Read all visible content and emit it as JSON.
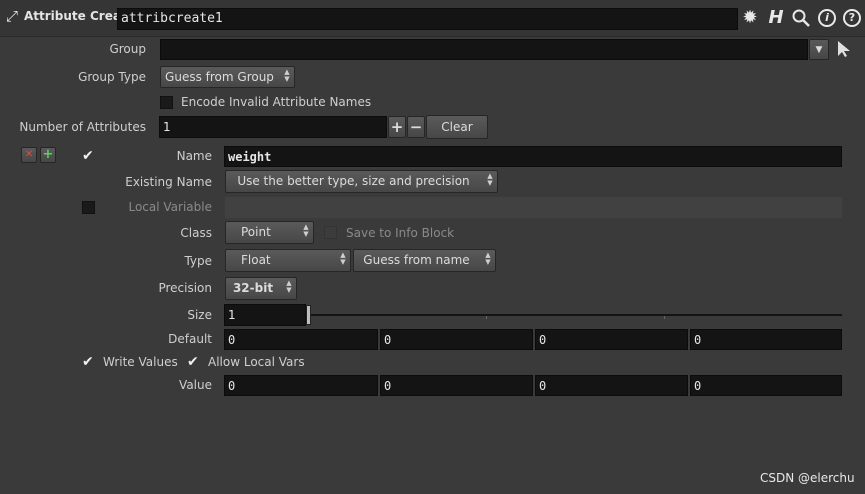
{
  "header": {
    "node_type": "Attribute Create",
    "node_name": "attribcreate1",
    "icons": [
      "node-type-icon",
      "gear-icon",
      "houdini-h-icon",
      "search-icon",
      "info-icon",
      "help-icon"
    ]
  },
  "group": {
    "label": "Group",
    "value": ""
  },
  "group_type": {
    "label": "Group Type",
    "value": "Guess from Group"
  },
  "encode_invalid": {
    "label": "Encode Invalid Attribute Names",
    "checked": false
  },
  "num_attributes": {
    "label": "Number of Attributes",
    "value": "1",
    "plus": "+",
    "minus": "−",
    "clear_label": "Clear"
  },
  "multiparm": {
    "remove": "✕",
    "insert": "+",
    "enabled": true
  },
  "name": {
    "label": "Name",
    "value": "weight"
  },
  "existing_name": {
    "label": "Existing Name",
    "value": "Use the better type, size and precision"
  },
  "local_variable": {
    "label": "Local Variable",
    "value": "",
    "checked": false
  },
  "class": {
    "label": "Class",
    "value": "Point"
  },
  "save_info": {
    "label": "Save to Info Block",
    "checked": false
  },
  "type": {
    "label": "Type",
    "value": "Float",
    "typeinfo": "Guess from name"
  },
  "precision": {
    "label": "Precision",
    "value": "32-bit"
  },
  "size": {
    "label": "Size",
    "value": "1",
    "slider_fraction": 0.0
  },
  "default": {
    "label": "Default",
    "values": [
      "0",
      "0",
      "0",
      "0"
    ]
  },
  "write_values": {
    "label": "Write Values",
    "checked": true
  },
  "allow_local_vars": {
    "label": "Allow Local Vars",
    "checked": true
  },
  "value": {
    "label": "Value",
    "values": [
      "0",
      "0",
      "0",
      "0"
    ]
  },
  "watermark": "CSDN @elerchu",
  "colors": {
    "bg": "#3a3a3a",
    "field": "#141414",
    "remove_red": "#c0392b",
    "insert_green": "#2f8f3a"
  }
}
